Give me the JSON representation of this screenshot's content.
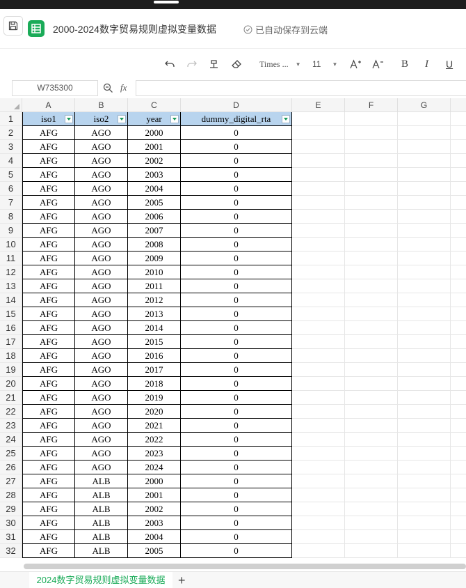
{
  "title_bar": {
    "document_title": "2000-2024数字贸易规则虚拟变量数据",
    "save_status": "已自动保存到云端",
    "app_color": "#1aab58"
  },
  "toolbar": {
    "font_name": "Times ...",
    "font_size": "11",
    "bold_label": "B",
    "italic_label": "I",
    "underline_label": "U",
    "icons": [
      "undo-icon",
      "redo-icon",
      "format-painter-icon",
      "eraser-icon",
      "increase-font-icon",
      "decrease-font-icon"
    ]
  },
  "formula_bar": {
    "cell_reference": "W735300",
    "formula_value": ""
  },
  "sheet": {
    "columns": [
      "A",
      "B",
      "C",
      "D",
      "E",
      "F",
      "G"
    ],
    "header_fill": "#b8d4ee",
    "headers": [
      "iso1",
      "iso2",
      "year",
      "dummy_digital_rta"
    ],
    "rows": [
      [
        "AFG",
        "AGO",
        "2000",
        "0"
      ],
      [
        "AFG",
        "AGO",
        "2001",
        "0"
      ],
      [
        "AFG",
        "AGO",
        "2002",
        "0"
      ],
      [
        "AFG",
        "AGO",
        "2003",
        "0"
      ],
      [
        "AFG",
        "AGO",
        "2004",
        "0"
      ],
      [
        "AFG",
        "AGO",
        "2005",
        "0"
      ],
      [
        "AFG",
        "AGO",
        "2006",
        "0"
      ],
      [
        "AFG",
        "AGO",
        "2007",
        "0"
      ],
      [
        "AFG",
        "AGO",
        "2008",
        "0"
      ],
      [
        "AFG",
        "AGO",
        "2009",
        "0"
      ],
      [
        "AFG",
        "AGO",
        "2010",
        "0"
      ],
      [
        "AFG",
        "AGO",
        "2011",
        "0"
      ],
      [
        "AFG",
        "AGO",
        "2012",
        "0"
      ],
      [
        "AFG",
        "AGO",
        "2013",
        "0"
      ],
      [
        "AFG",
        "AGO",
        "2014",
        "0"
      ],
      [
        "AFG",
        "AGO",
        "2015",
        "0"
      ],
      [
        "AFG",
        "AGO",
        "2016",
        "0"
      ],
      [
        "AFG",
        "AGO",
        "2017",
        "0"
      ],
      [
        "AFG",
        "AGO",
        "2018",
        "0"
      ],
      [
        "AFG",
        "AGO",
        "2019",
        "0"
      ],
      [
        "AFG",
        "AGO",
        "2020",
        "0"
      ],
      [
        "AFG",
        "AGO",
        "2021",
        "0"
      ],
      [
        "AFG",
        "AGO",
        "2022",
        "0"
      ],
      [
        "AFG",
        "AGO",
        "2023",
        "0"
      ],
      [
        "AFG",
        "AGO",
        "2024",
        "0"
      ],
      [
        "AFG",
        "ALB",
        "2000",
        "0"
      ],
      [
        "AFG",
        "ALB",
        "2001",
        "0"
      ],
      [
        "AFG",
        "ALB",
        "2002",
        "0"
      ],
      [
        "AFG",
        "ALB",
        "2003",
        "0"
      ],
      [
        "AFG",
        "ALB",
        "2004",
        "0"
      ],
      [
        "AFG",
        "ALB",
        "2005",
        "0"
      ]
    ]
  },
  "tabs": {
    "active_sheet": "2024数字贸易规则虚拟变量数据",
    "add_label": "+"
  }
}
